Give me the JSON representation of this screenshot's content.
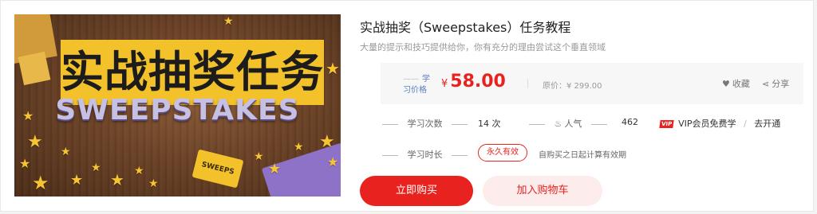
{
  "banner": {
    "title_cn": "实战抽奖任务",
    "title_en": "SWEEPSTAKES",
    "ticket_text": "SWEEPS"
  },
  "course": {
    "title": "实战抽奖（Sweepstakes）任务教程",
    "subtitle": "大量的提示和技巧提供给你，你有充分的理由尝试这个垂直领域"
  },
  "price": {
    "label": "学习价格",
    "currency": "¥",
    "current": "58.00",
    "original": "原价：¥ 299.00"
  },
  "actions": {
    "favorite": "收藏",
    "share": "分享",
    "buy_now": "立即购买",
    "add_cart": "加入购物车"
  },
  "stats": {
    "study_count_label": "学习次数",
    "study_count_value": "14 次",
    "popularity_label": "人气",
    "popularity_value": "462",
    "vip_badge": "VIP",
    "vip_text": "VIP会员免费学",
    "vip_sep": "/",
    "vip_link": "去开通",
    "duration_label": "学习时长",
    "duration_value": "永久有效",
    "duration_note": "自购买之日起计算有效期"
  },
  "colors": {
    "accent": "#e8231f",
    "banner_yellow": "#f3c22a",
    "link_blue": "#5a7fbf"
  },
  "icons": {
    "favorite": "heart-icon",
    "share": "share-icon",
    "popularity": "flame-icon"
  }
}
